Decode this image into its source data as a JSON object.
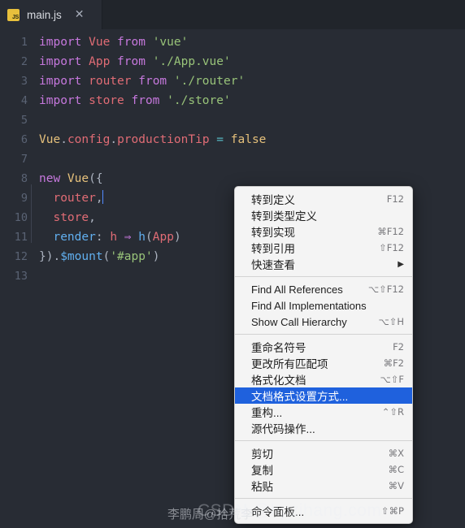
{
  "tab": {
    "icon": "js-file-icon",
    "label": "main.js",
    "close": "✕"
  },
  "editor": {
    "lines": [
      {
        "no": "1",
        "tokens": [
          {
            "t": "import ",
            "c": "kw"
          },
          {
            "t": "Vue",
            "c": "id"
          },
          {
            "t": " from ",
            "c": "kw"
          },
          {
            "t": "'vue'",
            "c": "str"
          }
        ]
      },
      {
        "no": "2",
        "tokens": [
          {
            "t": "import ",
            "c": "kw"
          },
          {
            "t": "App",
            "c": "id"
          },
          {
            "t": " from ",
            "c": "kw"
          },
          {
            "t": "'./App.vue'",
            "c": "str"
          }
        ]
      },
      {
        "no": "3",
        "tokens": [
          {
            "t": "import ",
            "c": "kw"
          },
          {
            "t": "router",
            "c": "id"
          },
          {
            "t": " from ",
            "c": "kw"
          },
          {
            "t": "'./router'",
            "c": "str"
          }
        ]
      },
      {
        "no": "4",
        "tokens": [
          {
            "t": "import ",
            "c": "kw"
          },
          {
            "t": "store",
            "c": "id"
          },
          {
            "t": " from ",
            "c": "kw"
          },
          {
            "t": "'./store'",
            "c": "str"
          }
        ]
      },
      {
        "no": "5",
        "tokens": []
      },
      {
        "no": "6",
        "tokens": [
          {
            "t": "Vue",
            "c": "cls"
          },
          {
            "t": ".",
            "c": "pun"
          },
          {
            "t": "config",
            "c": "id"
          },
          {
            "t": ".",
            "c": "pun"
          },
          {
            "t": "productionTip",
            "c": "id"
          },
          {
            "t": " ",
            "c": "pun"
          },
          {
            "t": "=",
            "c": "op"
          },
          {
            "t": " ",
            "c": "pun"
          },
          {
            "t": "false",
            "c": "cls"
          }
        ]
      },
      {
        "no": "7",
        "tokens": []
      },
      {
        "no": "8",
        "tokens": [
          {
            "t": "new ",
            "c": "kw"
          },
          {
            "t": "Vue",
            "c": "cls"
          },
          {
            "t": "({",
            "c": "pun"
          }
        ]
      },
      {
        "no": "9",
        "tokens": [
          {
            "t": "  ",
            "c": "ind"
          },
          {
            "t": "router",
            "c": "id"
          },
          {
            "t": ",",
            "c": "pun"
          }
        ],
        "caret": true
      },
      {
        "no": "10",
        "tokens": [
          {
            "t": "  ",
            "c": "ind"
          },
          {
            "t": "store",
            "c": "id"
          },
          {
            "t": ",",
            "c": "pun"
          }
        ]
      },
      {
        "no": "11",
        "tokens": [
          {
            "t": "  ",
            "c": "ind"
          },
          {
            "t": "render",
            "c": "fn"
          },
          {
            "t": ": ",
            "c": "pun"
          },
          {
            "t": "h",
            "c": "id"
          },
          {
            "t": " ⇒ ",
            "c": "kw"
          },
          {
            "t": "h",
            "c": "fn"
          },
          {
            "t": "(",
            "c": "pun"
          },
          {
            "t": "App",
            "c": "id"
          },
          {
            "t": ")",
            "c": "pun"
          }
        ]
      },
      {
        "no": "12",
        "tokens": [
          {
            "t": "}).",
            "c": "pun"
          },
          {
            "t": "$mount",
            "c": "fn"
          },
          {
            "t": "(",
            "c": "pun"
          },
          {
            "t": "'#app'",
            "c": "str"
          },
          {
            "t": ")",
            "c": "pun"
          }
        ]
      },
      {
        "no": "13",
        "tokens": []
      }
    ]
  },
  "context_menu": {
    "groups": [
      {
        "items": [
          {
            "label": "转到定义",
            "key": "F12",
            "zh": true
          },
          {
            "label": "转到类型定义",
            "key": "",
            "zh": true
          },
          {
            "label": "转到实现",
            "key": "⌘F12",
            "zh": true
          },
          {
            "label": "转到引用",
            "key": "⇧F12",
            "zh": true
          },
          {
            "label": "快速查看",
            "key": "",
            "zh": true,
            "submenu": "▶"
          }
        ]
      },
      {
        "items": [
          {
            "label": "Find All References",
            "key": "⌥⇧F12",
            "zh": false
          },
          {
            "label": "Find All Implementations",
            "key": "",
            "zh": false
          },
          {
            "label": "Show Call Hierarchy",
            "key": "⌥⇧H",
            "zh": false
          }
        ]
      },
      {
        "items": [
          {
            "label": "重命名符号",
            "key": "F2",
            "zh": true
          },
          {
            "label": "更改所有匹配项",
            "key": "⌘F2",
            "zh": true
          },
          {
            "label": "格式化文档",
            "key": "⌥⇧F",
            "zh": true
          },
          {
            "label": "文档格式设置方式...",
            "key": "",
            "zh": true,
            "selected": true
          },
          {
            "label": "重构...",
            "key": "⌃⇧R",
            "zh": true
          },
          {
            "label": "源代码操作...",
            "key": "",
            "zh": true
          }
        ]
      },
      {
        "items": [
          {
            "label": "剪切",
            "key": "⌘X",
            "zh": true
          },
          {
            "label": "复制",
            "key": "⌘C",
            "zh": true
          },
          {
            "label": "粘贴",
            "key": "⌘V",
            "zh": true
          }
        ]
      },
      {
        "items": [
          {
            "label": "命令面板...",
            "key": "⇧⌘P",
            "zh": true
          }
        ]
      }
    ]
  },
  "watermark": {
    "author": "李鹏周@拾荒李",
    "site": "CSDN @hpzihang.com"
  },
  "colors": {
    "editor_bg": "#282c34",
    "tabbar_bg": "#21252b",
    "menu_bg": "#f4f4f4",
    "menu_selected": "#1f61dd",
    "keyword": "#c678dd",
    "identifier": "#e06c75",
    "string": "#98c379",
    "function": "#61afef",
    "class": "#e5c07b",
    "operator": "#56b6c2",
    "caret": "#528bff"
  }
}
